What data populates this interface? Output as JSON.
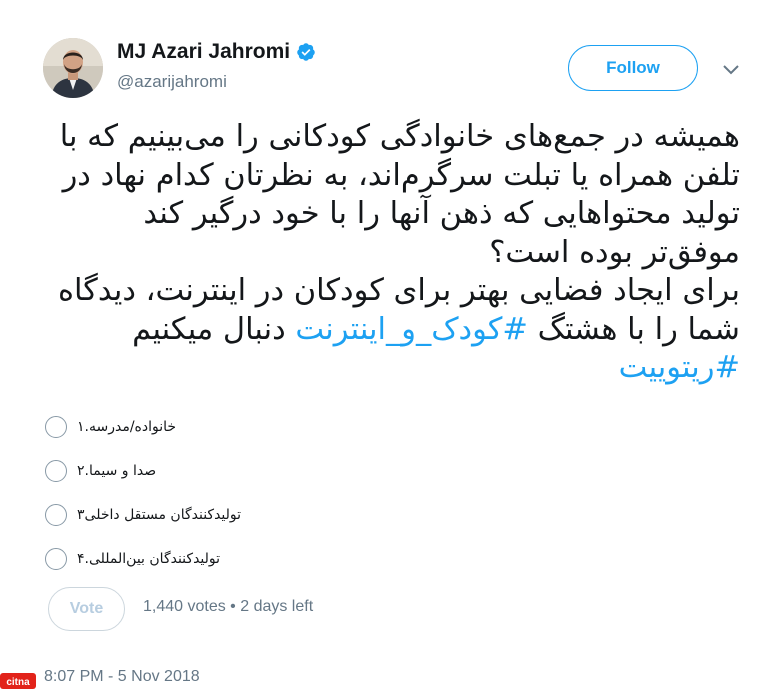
{
  "author": {
    "name": "MJ Azari Jahromi",
    "handle": "@azarijahromi",
    "verified": true
  },
  "follow_label": "Follow",
  "tweet": {
    "text_before_hashtag1": "همیشه در جمع‌های خانوادگی کودکانی را می‌بینیم که با تلفن همراه یا تبلت سرگرم‌اند، به نظرتان کدام نهاد در تولید محتواهایی که ذهن آنها را با خود درگیر کند موفق‌تر بوده است؟",
    "text_line2": "برای ایجاد فضایی بهتر برای کودکان در اینترنت، دیدگاه شما را با هشتگ",
    "hashtag1": "#کودک_و_اینترنت",
    "text_middle": "دنبال میکنیم",
    "hashtag2": "#ریتوییت"
  },
  "poll": {
    "options": [
      "خانواده/مدرسه.۱",
      "صدا و سیما.۲",
      "تولیدکنندگان مستقل داخلی۳",
      "تولیدکنندگان بین‌المللی.۴"
    ],
    "vote_label": "Vote",
    "meta": "1,440 votes • 2 days left"
  },
  "timestamp": "8:07 PM - 5 Nov 2018",
  "watermark": "citna",
  "colors": {
    "accent": "#1da1f2",
    "text": "#14171a",
    "muted": "#657786",
    "watermark_red": "#e2231a"
  },
  "icons": {
    "verified": "verified-badge-icon",
    "more": "chevron-down-icon"
  }
}
